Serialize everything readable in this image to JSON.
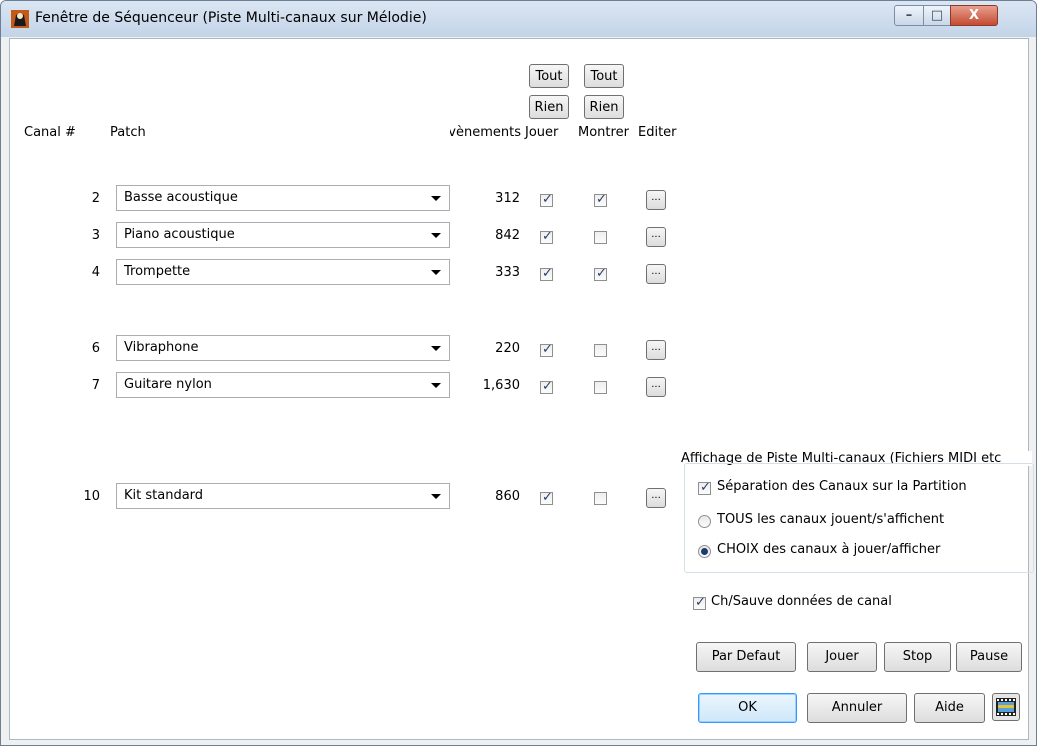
{
  "window": {
    "title": "Fenêtre de Séquenceur (Piste Multi-canaux sur Mélodie)",
    "controls": {
      "minimize": "–",
      "maximize": "□",
      "close": "X"
    }
  },
  "header": {
    "tout_jouer": "Tout",
    "tout_montrer": "Tout",
    "rien_jouer": "Rien",
    "rien_montrer": "Rien",
    "col_canal": "Canal #",
    "col_patch": "Patch",
    "col_events": "vènements",
    "col_jouer": "Jouer",
    "col_montrer": "Montrer",
    "col_editer": "Editer"
  },
  "rows": [
    {
      "canal": "2",
      "patch": "Basse acoustique",
      "events": "312",
      "jouer": true,
      "montrer": true,
      "edit": "..."
    },
    {
      "canal": "3",
      "patch": "Piano acoustique",
      "events": "842",
      "jouer": true,
      "montrer": false,
      "edit": "..."
    },
    {
      "canal": "4",
      "patch": "Trompette",
      "events": "333",
      "jouer": true,
      "montrer": true,
      "edit": "..."
    },
    {
      "canal": "6",
      "patch": "Vibraphone",
      "events": "220",
      "jouer": true,
      "montrer": false,
      "edit": "..."
    },
    {
      "canal": "7",
      "patch": "Guitare nylon",
      "events": "1,630",
      "jouer": true,
      "montrer": false,
      "edit": "..."
    },
    {
      "canal": "10",
      "patch": "Kit standard",
      "events": "860",
      "jouer": true,
      "montrer": false,
      "edit": "..."
    }
  ],
  "display_group": {
    "title": "Affichage de Piste Multi-canaux (Fichiers MIDI etc",
    "separation_label": "Séparation des Canaux sur la Partition",
    "separation_checked": true,
    "all_label": "TOUS les canaux jouent/s'affichent",
    "choice_label": "CHOIX des canaux à jouer/afficher",
    "selected": "choice"
  },
  "save_data": {
    "label": "Ch/Sauve données de canal",
    "checked": true
  },
  "buttons": {
    "default": "Par Defaut",
    "play": "Jouer",
    "stop": "Stop",
    "pause": "Pause",
    "ok": "OK",
    "cancel": "Annuler",
    "help": "Aide"
  },
  "check_glyph": "✓",
  "colors": {
    "accent": "#3399ff",
    "check": "#2c3f67"
  }
}
